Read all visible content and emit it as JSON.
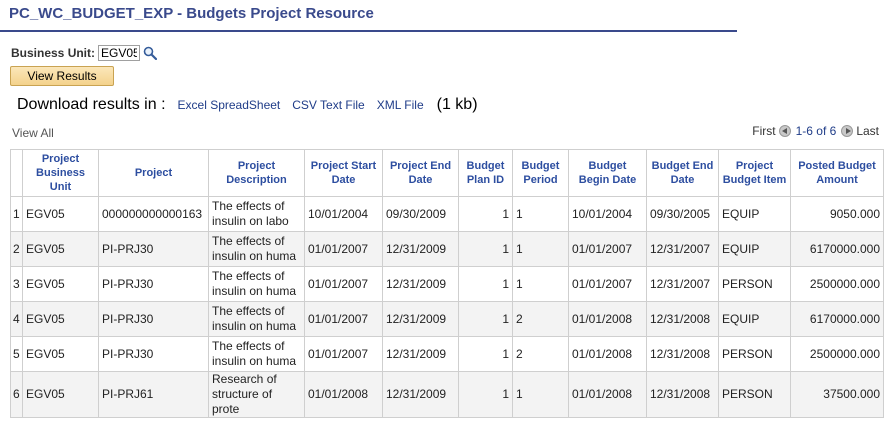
{
  "page": {
    "title": "PC_WC_BUDGET_EXP - Budgets Project Resource"
  },
  "filter": {
    "business_unit_label": "Business Unit:",
    "business_unit_value": "EGV05",
    "lookup_icon": "magnifier-icon"
  },
  "buttons": {
    "view_results": "View Results"
  },
  "download": {
    "label": "Download results in :",
    "excel": "Excel SpreadSheet",
    "csv": "CSV Text File",
    "xml": "XML File",
    "size": "(1 kb)"
  },
  "navigation": {
    "view_all": "View All",
    "first": "First",
    "range": "1-6 of 6",
    "last": "Last"
  },
  "table": {
    "columns": [
      "",
      "Project Business Unit",
      "Project",
      "Project Description",
      "Project Start Date",
      "Project End Date",
      "Budget Plan ID",
      "Budget Period",
      "Budget Begin Date",
      "Budget End Date",
      "Project Budget Item",
      "Posted Budget Amount"
    ],
    "rows": [
      [
        "1",
        "EGV05",
        "000000000000163",
        "The effects of insulin on labo",
        "10/01/2004",
        "09/30/2009",
        "1",
        "1",
        "10/01/2004",
        "09/30/2005",
        "EQUIP",
        "9050.000"
      ],
      [
        "2",
        "EGV05",
        "PI-PRJ30",
        "The effects of insulin on huma",
        "01/01/2007",
        "12/31/2009",
        "1",
        "1",
        "01/01/2007",
        "12/31/2007",
        "EQUIP",
        "6170000.000"
      ],
      [
        "3",
        "EGV05",
        "PI-PRJ30",
        "The effects of insulin on huma",
        "01/01/2007",
        "12/31/2009",
        "1",
        "1",
        "01/01/2007",
        "12/31/2007",
        "PERSON",
        "2500000.000"
      ],
      [
        "4",
        "EGV05",
        "PI-PRJ30",
        "The effects of insulin on huma",
        "01/01/2007",
        "12/31/2009",
        "1",
        "2",
        "01/01/2008",
        "12/31/2008",
        "EQUIP",
        "6170000.000"
      ],
      [
        "5",
        "EGV05",
        "PI-PRJ30",
        "The effects of insulin on huma",
        "01/01/2007",
        "12/31/2009",
        "1",
        "2",
        "01/01/2008",
        "12/31/2008",
        "PERSON",
        "2500000.000"
      ],
      [
        "6",
        "EGV05",
        "PI-PRJ61",
        "Research of structure of prote",
        "01/01/2008",
        "12/31/2009",
        "1",
        "1",
        "01/01/2008",
        "12/31/2008",
        "PERSON",
        "37500.000"
      ]
    ]
  }
}
